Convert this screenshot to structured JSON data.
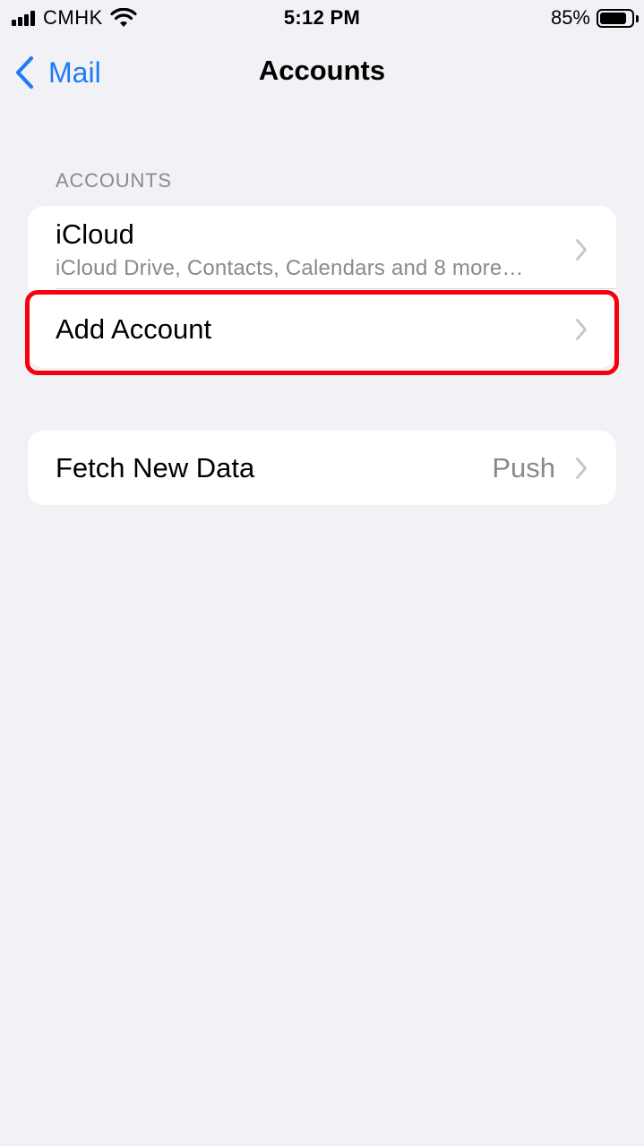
{
  "status_bar": {
    "carrier": "CMHK",
    "time": "5:12 PM",
    "battery_percent": "85%",
    "battery_level": 0.85
  },
  "nav": {
    "back_label": "Mail",
    "title": "Accounts"
  },
  "accounts_section": {
    "header": "ACCOUNTS",
    "rows": [
      {
        "title": "iCloud",
        "subtitle": "iCloud Drive, Contacts, Calendars and 8 more…"
      },
      {
        "title": "Add Account"
      }
    ]
  },
  "fetch_section": {
    "title": "Fetch New Data",
    "value": "Push"
  },
  "colors": {
    "accent": "#1D7BF5",
    "background": "#F1F1F6",
    "secondary_text": "#8A8A8E",
    "highlight": "#F5000D"
  },
  "icons": [
    "signal-icon",
    "wifi-icon",
    "battery-icon",
    "back-chevron-icon",
    "chevron-right-icon"
  ]
}
